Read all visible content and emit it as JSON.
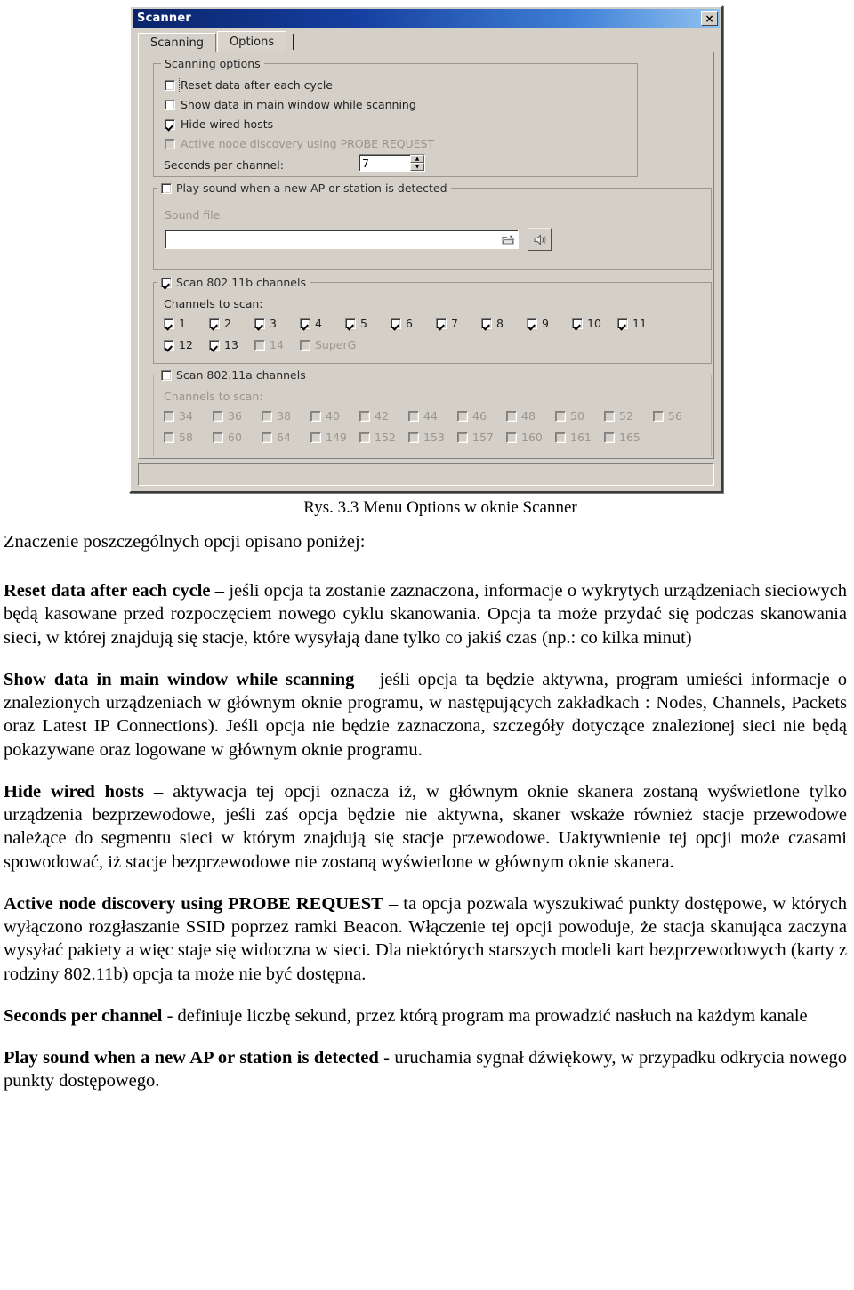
{
  "window": {
    "title": "Scanner",
    "close_label": "×",
    "tabs": [
      {
        "label": "Scanning",
        "active": false
      },
      {
        "label": "Options",
        "active": true
      }
    ]
  },
  "scanning_options": {
    "group_label": "Scanning options",
    "checkboxes": [
      {
        "label": "Reset data after each cycle",
        "checked": false,
        "disabled": false,
        "focused": true
      },
      {
        "label": "Show data in main window while scanning",
        "checked": false,
        "disabled": false,
        "focused": false
      },
      {
        "label": "Hide wired hosts",
        "checked": true,
        "disabled": false,
        "focused": false
      },
      {
        "label": "Active node discovery using PROBE REQUEST",
        "checked": false,
        "disabled": true,
        "focused": false
      }
    ],
    "seconds_label": "Seconds per channel:",
    "seconds_value": "7",
    "spin_up": "▲",
    "spin_down": "▼"
  },
  "sound": {
    "group_label": "Play sound when a new AP or station is detected",
    "group_checked": false,
    "file_label": "Sound file:",
    "file_value": "",
    "file_placeholder": "",
    "browse_icon": "folder-open-icon",
    "play_icon": "speaker-icon"
  },
  "channels_b": {
    "group_label": "Scan 802.11b channels",
    "group_checked": true,
    "sub_label": "Channels to scan:",
    "row1": [
      {
        "label": "1",
        "checked": true,
        "disabled": false
      },
      {
        "label": "2",
        "checked": true,
        "disabled": false
      },
      {
        "label": "3",
        "checked": true,
        "disabled": false
      },
      {
        "label": "4",
        "checked": true,
        "disabled": false
      },
      {
        "label": "5",
        "checked": true,
        "disabled": false
      },
      {
        "label": "6",
        "checked": true,
        "disabled": false
      },
      {
        "label": "7",
        "checked": true,
        "disabled": false
      },
      {
        "label": "8",
        "checked": true,
        "disabled": false
      },
      {
        "label": "9",
        "checked": true,
        "disabled": false
      },
      {
        "label": "10",
        "checked": true,
        "disabled": false
      },
      {
        "label": "11",
        "checked": true,
        "disabled": false
      }
    ],
    "row2": [
      {
        "label": "12",
        "checked": true,
        "disabled": false
      },
      {
        "label": "13",
        "checked": true,
        "disabled": false
      },
      {
        "label": "14",
        "checked": false,
        "disabled": true
      },
      {
        "label": "SuperG",
        "checked": false,
        "disabled": true
      }
    ]
  },
  "channels_a": {
    "group_label": "Scan 802.11a channels",
    "group_checked": false,
    "sub_label": "Channels to scan:",
    "row1": [
      {
        "label": "34",
        "checked": false,
        "disabled": true
      },
      {
        "label": "36",
        "checked": false,
        "disabled": true
      },
      {
        "label": "38",
        "checked": false,
        "disabled": true
      },
      {
        "label": "40",
        "checked": false,
        "disabled": true
      },
      {
        "label": "42",
        "checked": false,
        "disabled": true
      },
      {
        "label": "44",
        "checked": false,
        "disabled": true
      },
      {
        "label": "46",
        "checked": false,
        "disabled": true
      },
      {
        "label": "48",
        "checked": false,
        "disabled": true
      },
      {
        "label": "50",
        "checked": false,
        "disabled": true
      },
      {
        "label": "52",
        "checked": false,
        "disabled": true
      },
      {
        "label": "56",
        "checked": false,
        "disabled": true
      }
    ],
    "row2": [
      {
        "label": "58",
        "checked": false,
        "disabled": true
      },
      {
        "label": "60",
        "checked": false,
        "disabled": true
      },
      {
        "label": "64",
        "checked": false,
        "disabled": true
      },
      {
        "label": "149",
        "checked": false,
        "disabled": true
      },
      {
        "label": "152",
        "checked": false,
        "disabled": true
      },
      {
        "label": "153",
        "checked": false,
        "disabled": true
      },
      {
        "label": "157",
        "checked": false,
        "disabled": true
      },
      {
        "label": "160",
        "checked": false,
        "disabled": true
      },
      {
        "label": "161",
        "checked": false,
        "disabled": true
      },
      {
        "label": "165",
        "checked": false,
        "disabled": true
      }
    ]
  },
  "document": {
    "figure_caption": "Rys. 3.3 Menu Options w oknie Scanner",
    "intro": "Znaczenie poszczególnych opcji opisano poniżej:",
    "sections": [
      {
        "term": "Reset data after each cycle",
        "body": " – jeśli opcja ta zostanie zaznaczona, informacje o wykrytych urządzeniach sieciowych będą kasowane przed rozpoczęciem nowego cyklu skanowania. Opcja ta może przydać się podczas skanowania sieci, w której znajdują się stacje, które wysyłają dane tylko co jakiś czas (np.: co kilka minut)"
      },
      {
        "term": "Show data in main window while scanning",
        "body": " – jeśli opcja ta będzie aktywna, program umieści informacje o znalezionych urządzeniach w głównym oknie programu, w następujących zakładkach : Nodes, Channels, Packets oraz Latest IP Connections). Jeśli opcja nie będzie zaznaczona, szczegóły dotyczące znalezionej sieci nie będą pokazywane oraz logowane w głównym oknie programu."
      },
      {
        "term": "Hide wired hosts",
        "body": " – aktywacja tej opcji oznacza iż, w głównym oknie skanera zostaną wyświetlone tylko urządzenia bezprzewodowe, jeśli zaś opcja będzie nie aktywna, skaner wskaże również stacje przewodowe należące do segmentu sieci w którym znajdują się stacje przewodowe. Uaktywnienie tej opcji może czasami spowodować, iż stacje bezprzewodowe nie zostaną wyświetlone w głównym oknie skanera."
      },
      {
        "term": "Active node discovery using PROBE REQUEST",
        "body": " – ta opcja pozwala wyszukiwać punkty dostępowe, w  których wyłączono rozgłaszanie SSID poprzez ramki Beacon. Włączenie tej opcji powoduje, że stacja skanująca zaczyna wysyłać pakiety a więc staje się widoczna w sieci. Dla niektórych starszych modeli kart bezprzewodowych (karty z rodziny 802.11b) opcja ta może nie być dostępna."
      },
      {
        "term": "Seconds per channel",
        "body": "  - definiuje liczbę sekund, przez którą program ma prowadzić nasłuch na każdym kanale"
      },
      {
        "term": "Play sound when a new AP or station is detected",
        "body": "  - uruchamia sygnał dźwiękowy, w przypadku odkrycia nowego punkty dostępowego."
      }
    ]
  }
}
